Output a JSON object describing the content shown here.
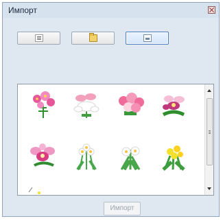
{
  "window": {
    "title": "Импорт"
  },
  "toolbar": {
    "buttons": [
      {
        "name": "list-view-button",
        "icon": "list-icon",
        "active": false
      },
      {
        "name": "open-folder-button",
        "icon": "folder-icon",
        "active": false
      },
      {
        "name": "thumbnail-view-button",
        "icon": "thumbnail-icon",
        "active": true
      }
    ]
  },
  "gallery": {
    "items": [
      {
        "name": "pink-cosmos",
        "colors": [
          "#e6579a",
          "#f28ac0",
          "#2f8f2f"
        ]
      },
      {
        "name": "peony-bouquet",
        "colors": [
          "#f3a0bd",
          "#ffffff",
          "#3f9f3f"
        ]
      },
      {
        "name": "pink-carnations",
        "colors": [
          "#f06a9a",
          "#ffd3df",
          "#3a983a"
        ]
      },
      {
        "name": "orchids",
        "colors": [
          "#c0387c",
          "#f6bfd8",
          "#2e8e2e"
        ]
      },
      {
        "name": "pink-orchid",
        "colors": [
          "#f098c4",
          "#d93c82",
          "#2f8b2f"
        ]
      },
      {
        "name": "white-daffodils",
        "colors": [
          "#ffffff",
          "#f6c23c",
          "#46a84a"
        ]
      },
      {
        "name": "narcissus",
        "colors": [
          "#ffffff",
          "#f3c34a",
          "#4aa64a"
        ]
      },
      {
        "name": "yellow-flowers",
        "colors": [
          "#f2e02b",
          "#ffd21f",
          "#3e9e3e"
        ]
      }
    ]
  },
  "footer": {
    "import_label": "Импорт"
  }
}
